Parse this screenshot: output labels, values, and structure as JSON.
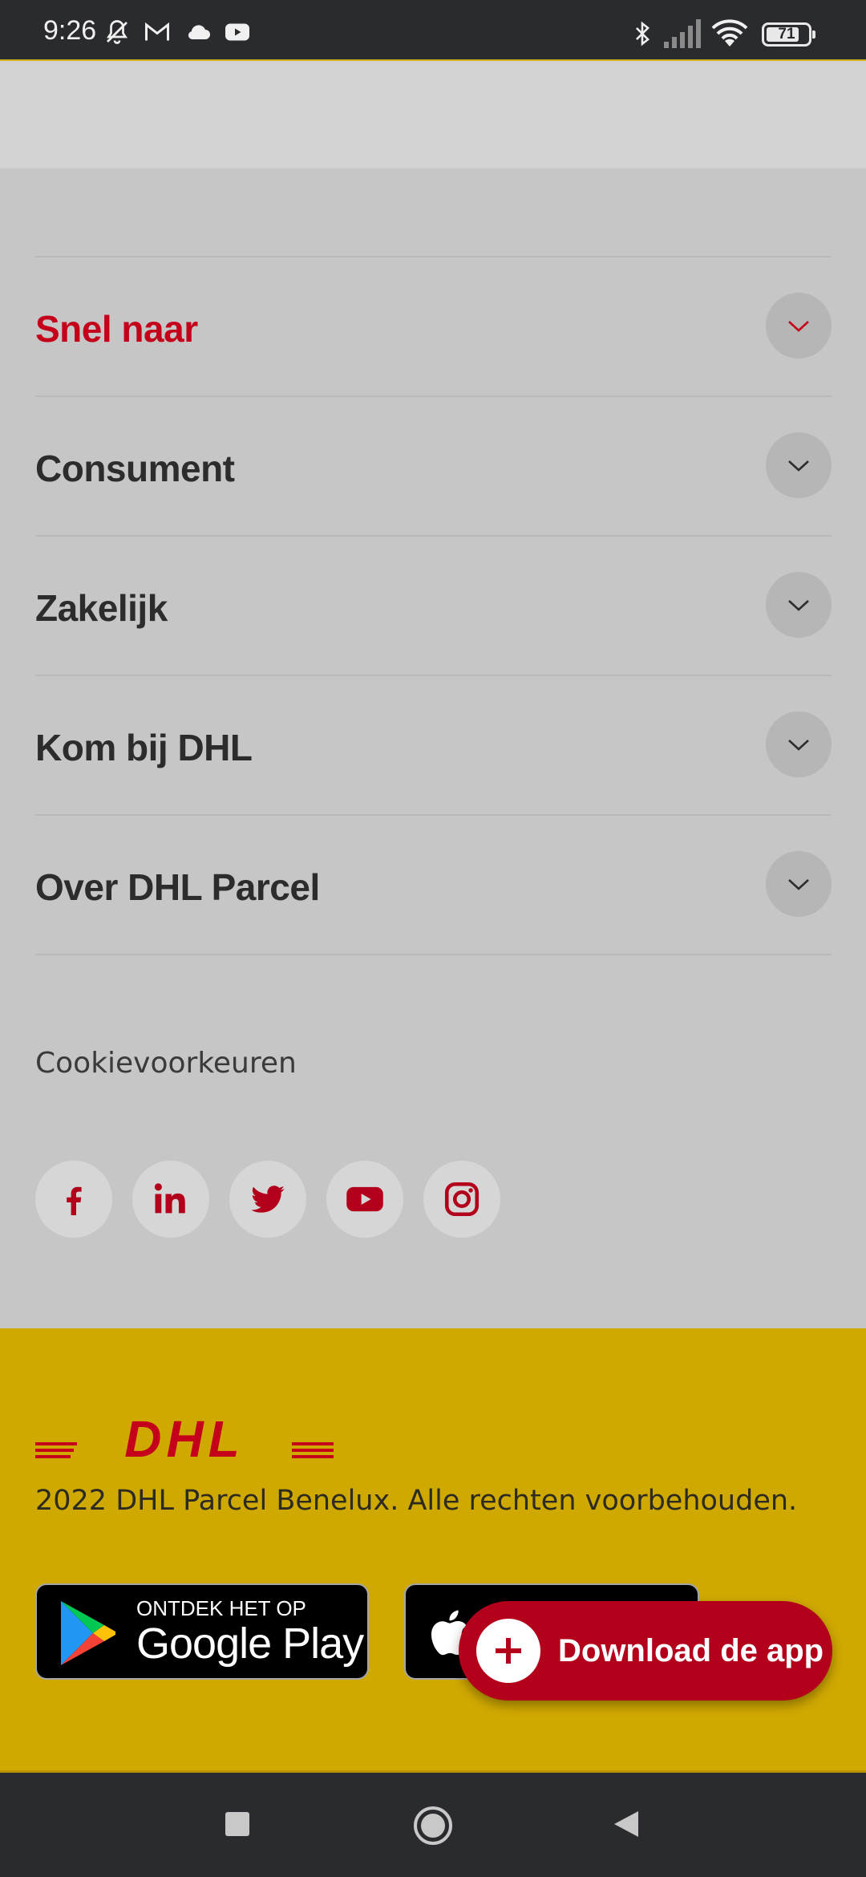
{
  "status_bar": {
    "time": "9:26",
    "icons": [
      "bell-off-icon",
      "gmail-icon",
      "cloud-icon",
      "youtube-icon",
      "bluetooth-icon",
      "signal-icon",
      "wifi-icon",
      "battery-icon"
    ],
    "battery": "71"
  },
  "footer_nav": {
    "items": [
      {
        "label": "Snel naar",
        "active": true
      },
      {
        "label": "Consument",
        "active": false
      },
      {
        "label": "Zakelijk",
        "active": false
      },
      {
        "label": "Kom bij DHL",
        "active": false
      },
      {
        "label": "Over DHL Parcel",
        "active": false
      }
    ]
  },
  "cookie_link": "Cookievoorkeuren",
  "social": [
    "facebook-icon",
    "linkedin-icon",
    "twitter-icon",
    "youtube-icon",
    "instagram-icon"
  ],
  "brand": {
    "logo_text": "DHL",
    "copyright": "2022 DHL Parcel Benelux. Alle rechten voorbehouden."
  },
  "stores": {
    "google_pre": "ONTDEK HET OP",
    "google_main": "Google Play"
  },
  "fab": {
    "label": "Download de app"
  },
  "colors": {
    "accent_red": "#c4001b",
    "footer_yellow": "#d0a900",
    "background_grey": "#c6c6c6"
  }
}
